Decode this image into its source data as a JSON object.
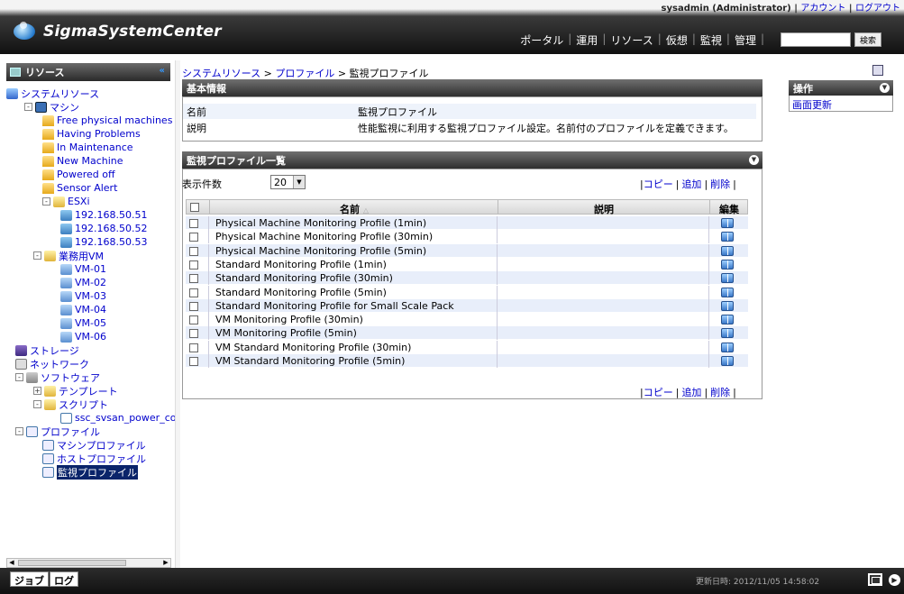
{
  "header": {
    "user": "sysadmin (Administrator)",
    "sep": " | ",
    "account_link": "アカウント",
    "logout_link": "ログアウト",
    "app_title": "SigmaSystemCenter",
    "nav": [
      "ポータル",
      "運用",
      "リソース",
      "仮想",
      "監視",
      "管理"
    ],
    "search_button": "検索"
  },
  "sidebar": {
    "title": "リソース",
    "tree": [
      {
        "label": "システムリソース",
        "level": 0,
        "icon": "sys"
      },
      {
        "label": "マシン",
        "level": 1,
        "icon": "mon",
        "toggle": "-"
      },
      {
        "label": "Free physical machines",
        "level": 2,
        "icon": "grp"
      },
      {
        "label": "Having Problems",
        "level": 2,
        "icon": "grp"
      },
      {
        "label": "In Maintenance",
        "level": 2,
        "icon": "grp"
      },
      {
        "label": "New Machine",
        "level": 2,
        "icon": "grp"
      },
      {
        "label": "Powered off",
        "level": 2,
        "icon": "grp"
      },
      {
        "label": "Sensor Alert",
        "level": 2,
        "icon": "grp"
      },
      {
        "label": "ESXi",
        "level": 2,
        "icon": "folder",
        "toggle": "-"
      },
      {
        "label": "192.168.50.51",
        "level": 3,
        "icon": "host"
      },
      {
        "label": "192.168.50.52",
        "level": 3,
        "icon": "host"
      },
      {
        "label": "192.168.50.53",
        "level": 3,
        "icon": "host"
      },
      {
        "label": "業務用VM",
        "level": 1.5,
        "icon": "folder",
        "toggle": "-"
      },
      {
        "label": "VM-01",
        "level": 3,
        "icon": "vm"
      },
      {
        "label": "VM-02",
        "level": 3,
        "icon": "vm"
      },
      {
        "label": "VM-03",
        "level": 3,
        "icon": "vm"
      },
      {
        "label": "VM-04",
        "level": 3,
        "icon": "vm"
      },
      {
        "label": "VM-05",
        "level": 3,
        "icon": "vm"
      },
      {
        "label": "VM-06",
        "level": 3,
        "icon": "vm"
      },
      {
        "label": "ストレージ",
        "level": 0.5,
        "icon": "stor"
      },
      {
        "label": "ネットワーク",
        "level": 0.5,
        "icon": "net"
      },
      {
        "label": "ソフトウェア",
        "level": 0.5,
        "icon": "soft",
        "toggle": "-"
      },
      {
        "label": "テンプレート",
        "level": 1.5,
        "icon": "folder",
        "toggle": "+"
      },
      {
        "label": "スクリプト",
        "level": 1.5,
        "icon": "folder",
        "toggle": "-"
      },
      {
        "label": "ssc_svsan_power_co",
        "level": 3,
        "icon": "doc"
      },
      {
        "label": "プロファイル",
        "level": 0.5,
        "icon": "prof",
        "toggle": "-"
      },
      {
        "label": "マシンプロファイル",
        "level": 2,
        "icon": "prof"
      },
      {
        "label": "ホストプロファイル",
        "level": 2,
        "icon": "prof"
      },
      {
        "label": "監視プロファイル",
        "level": 2,
        "icon": "prof",
        "selected": true
      }
    ]
  },
  "breadcrumb": {
    "items": [
      "システムリソース",
      "プロファイル"
    ],
    "separator": " > ",
    "current": "監視プロファイル"
  },
  "basic_info": {
    "title": "基本情報",
    "rows": [
      {
        "key": "名前",
        "value": "監視プロファイル"
      },
      {
        "key": "説明",
        "value": "性能監視に利用する監視プロファイル設定。名前付のプロファイルを定義できます。"
      }
    ]
  },
  "profile_list": {
    "title": "監視プロファイル一覧",
    "per_page_label": "表示件数",
    "per_page_value": "20",
    "actions": [
      "コピー",
      "追加",
      "削除"
    ],
    "action_sep": "|",
    "columns": {
      "name": "名前",
      "desc": "説明",
      "edit": "編集",
      "sort_mark": "△"
    },
    "rows": [
      "Physical Machine Monitoring Profile (1min)",
      "Physical Machine Monitoring Profile (30min)",
      "Physical Machine Monitoring Profile (5min)",
      "Standard Monitoring Profile (1min)",
      "Standard Monitoring Profile (30min)",
      "Standard Monitoring Profile (5min)",
      "Standard Monitoring Profile for Small Scale Pack",
      "VM Monitoring Profile (30min)",
      "VM Monitoring Profile (5min)",
      "VM Standard Monitoring Profile (30min)",
      "VM Standard Monitoring Profile (5min)"
    ]
  },
  "operations": {
    "title": "操作",
    "items": [
      "画面更新"
    ]
  },
  "footer": {
    "tabs": [
      "ジョブ",
      "ログ"
    ],
    "updated": "更新日時: 2012/11/05 14:58:02"
  }
}
